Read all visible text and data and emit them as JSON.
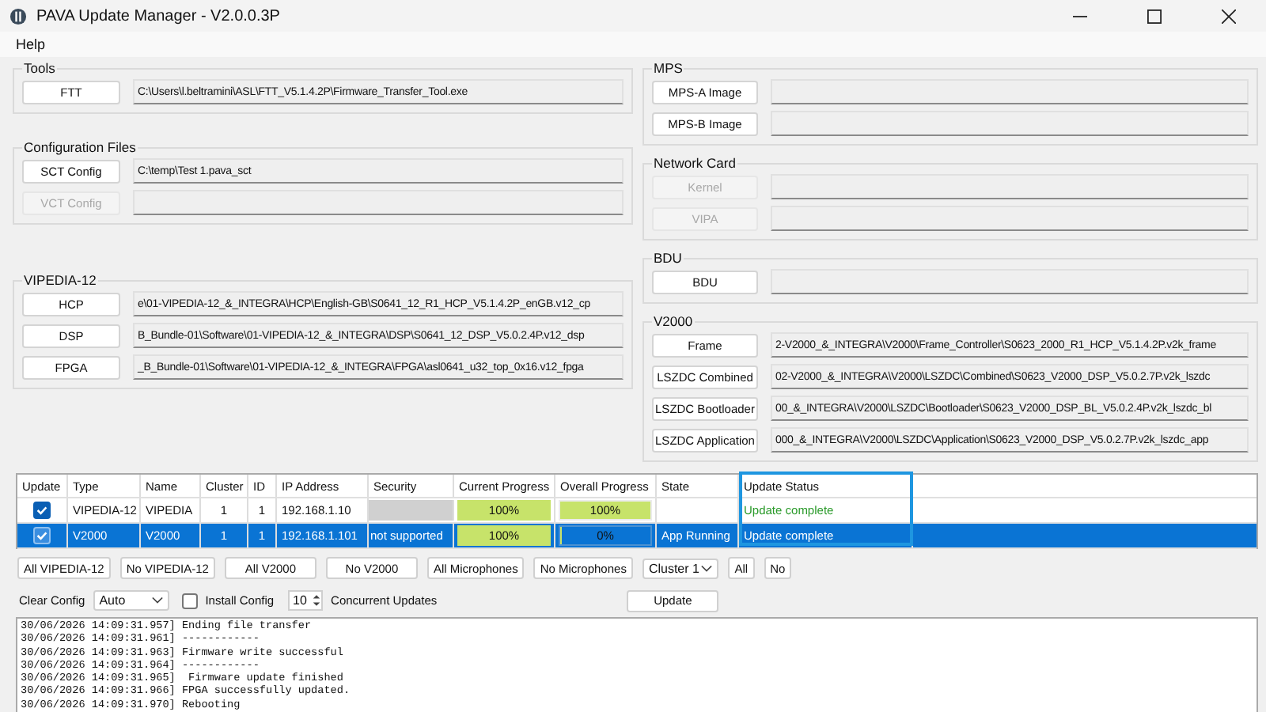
{
  "window": {
    "title": "PAVA Update Manager - V2.0.0.3P"
  },
  "menu": [
    "Help"
  ],
  "left_groups": [
    {
      "title": "Tools",
      "rows": [
        {
          "button": "FTT",
          "disabled": false,
          "path": "C:\\Users\\l.beltramini\\ASL\\FTT_V5.1.4.2P\\Firmware_Transfer_Tool.exe"
        }
      ]
    },
    {
      "title": "Configuration Files",
      "rows": [
        {
          "button": "SCT Config",
          "disabled": false,
          "path": "C:\\temp\\Test 1.pava_sct"
        },
        {
          "button": "VCT Config",
          "disabled": true
        }
      ]
    },
    {
      "title": "VIPEDIA-12",
      "rows": [
        {
          "button": "HCP",
          "disabled": false,
          "path": "e\\01-VIPEDIA-12_&_INTEGRA\\HCP\\English-GB\\S0641_12_R1_HCP_V5.1.4.2P_enGB.v12_cp"
        },
        {
          "button": "DSP",
          "disabled": false,
          "path": "B_Bundle-01\\Software\\01-VIPEDIA-12_&_INTEGRA\\DSP\\S0641_12_DSP_V5.0.2.4P.v12_dsp"
        },
        {
          "button": "FPGA",
          "disabled": false,
          "path": "_B_Bundle-01\\Software\\01-VIPEDIA-12_&_INTEGRA\\FPGA\\asl0641_u32_top_0x16.v12_fpga"
        }
      ]
    }
  ],
  "right_groups": [
    {
      "title": "MPS",
      "rows": [
        {
          "button": "MPS-A Image",
          "disabled": false
        },
        {
          "button": "MPS-B Image",
          "disabled": false
        }
      ]
    },
    {
      "title": "Network Card",
      "rows": [
        {
          "button": "Kernel",
          "disabled": true
        },
        {
          "button": "VIPA",
          "disabled": true
        }
      ]
    },
    {
      "title": "BDU",
      "rows": [
        {
          "button": "BDU",
          "disabled": false
        }
      ]
    },
    {
      "title": "V2000",
      "rows": [
        {
          "button": "Frame",
          "disabled": false,
          "path": "2-V2000_&_INTEGRA\\V2000\\Frame_Controller\\S0623_2000_R1_HCP_V5.1.4.2P.v2k_frame"
        },
        {
          "button": "LSZDC Combined",
          "disabled": false,
          "path": "02-V2000_&_INTEGRA\\V2000\\LSZDC\\Combined\\S0623_V2000_DSP_V5.0.2.7P.v2k_lszdc"
        },
        {
          "button": "LSZDC Bootloader",
          "disabled": false,
          "path": "00_&_INTEGRA\\V2000\\LSZDC\\Bootloader\\S0623_V2000_DSP_BL_V5.0.2.4P.v2k_lszdc_bl"
        },
        {
          "button": "LSZDC Application",
          "disabled": false,
          "path": "000_&_INTEGRA\\V2000\\LSZDC\\Application\\S0623_V2000_DSP_V5.0.2.7P.v2k_lszdc_app"
        }
      ]
    }
  ],
  "table": {
    "columns": [
      {
        "label": "Update",
        "highlighted": false
      },
      {
        "label": "Type",
        "highlighted": false
      },
      {
        "label": "Name",
        "highlighted": false
      },
      {
        "label": "Cluster",
        "highlighted": false
      },
      {
        "label": "ID",
        "highlighted": false
      },
      {
        "label": "IP Address",
        "highlighted": false
      },
      {
        "label": "Security",
        "highlighted": false
      },
      {
        "label": "Current Progress",
        "highlighted": false
      },
      {
        "label": "Overall Progress",
        "highlighted": false
      },
      {
        "label": "State",
        "highlighted": false
      },
      {
        "label": "Update Status",
        "highlighted": true
      }
    ],
    "rows": [
      {
        "selected": false,
        "checked": true,
        "type": "VIPEDIA-12",
        "name": "VIPEDIA",
        "cluster": "1",
        "id": "1",
        "ip": "192.168.1.10",
        "security": {
          "disabled": true
        },
        "current": {
          "text": "100%",
          "level": 1
        },
        "overall": {
          "text": "100%",
          "level": 1
        },
        "status": "Update complete"
      },
      {
        "selected": true,
        "checked": true,
        "type": "V2000",
        "name": "V2000",
        "cluster": "1",
        "id": "1",
        "ip": "192.168.1.101",
        "security": {
          "disabled": false,
          "text": "not supported"
        },
        "current": {
          "text": "100%",
          "level": 1
        },
        "overall": {
          "text": "0%",
          "level": 0
        },
        "state": "App Running",
        "status": "Update complete"
      }
    ]
  },
  "select_buttons": [
    "All VIPEDIA-12",
    "No VIPEDIA-12",
    "All V2000",
    "No V2000",
    "All Microphones",
    "No Microphones"
  ],
  "cluster": {
    "value": "Cluster 1",
    "buttons": [
      "All",
      "No"
    ]
  },
  "options": {
    "clear_config_label": "Clear Config",
    "clear_config": "Auto",
    "install_config": {
      "label": "Install Config",
      "checked": false
    },
    "concurrent": "10",
    "concurrent_label": "Concurrent Updates",
    "update_button": "Update"
  },
  "log": [
    "30/06/2026 14:09:31.957] Ending file transfer",
    "30/06/2026 14:09:31.961] ------------",
    "30/06/2026 14:09:31.963] Firmware write successful",
    "30/06/2026 14:09:31.964] ------------",
    "30/06/2026 14:09:31.965]  Firmware update finished",
    "30/06/2026 14:09:31.966] FPGA successfully updated.",
    "30/06/2026 14:09:31.970] Rebooting"
  ]
}
